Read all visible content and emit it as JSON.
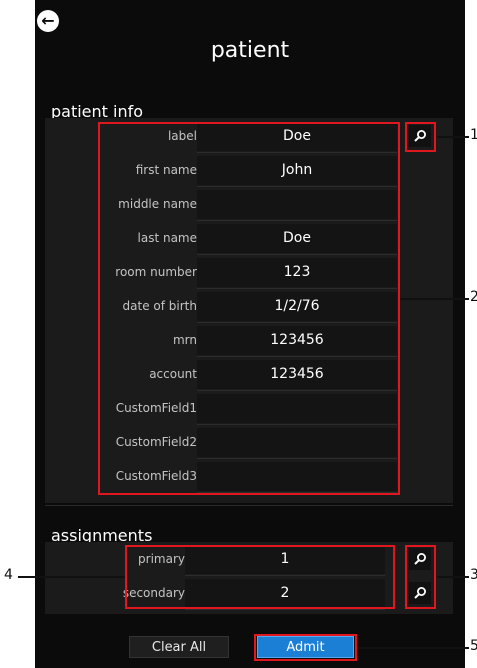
{
  "header": {
    "back_icon": "arrow-left-circle-icon",
    "title": "patient"
  },
  "patient_info": {
    "heading": "patient info",
    "fields": [
      {
        "label": "label",
        "value": "Doe"
      },
      {
        "label": "first name",
        "value": "John"
      },
      {
        "label": "middle name",
        "value": ""
      },
      {
        "label": "last name",
        "value": "Doe"
      },
      {
        "label": "room number",
        "value": "123"
      },
      {
        "label": "date of birth",
        "value": "1/2/76"
      },
      {
        "label": "mrn",
        "value": "123456"
      },
      {
        "label": "account",
        "value": "123456"
      },
      {
        "label": "CustomField1",
        "value": ""
      },
      {
        "label": "CustomField2",
        "value": ""
      },
      {
        "label": "CustomField3",
        "value": ""
      }
    ],
    "search_icon": "magnifier-icon"
  },
  "assignments": {
    "heading": "assignments",
    "fields": [
      {
        "label": "primary",
        "value": "1"
      },
      {
        "label": "secondary",
        "value": "2"
      }
    ]
  },
  "buttons": {
    "clear_all": "Clear All",
    "admit": "Admit"
  },
  "callouts": [
    "1",
    "2",
    "3",
    "4",
    "5"
  ],
  "colors": {
    "highlight": "#e0171f",
    "accent": "#1c7fd6",
    "background": "#0b0b0b"
  }
}
